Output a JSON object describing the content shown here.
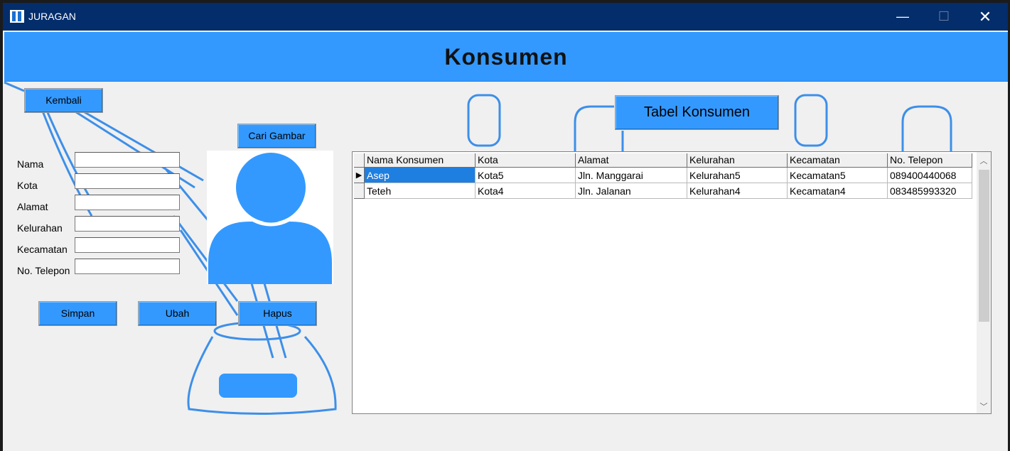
{
  "window": {
    "title": "JURAGAN",
    "minimize_glyph": "—",
    "maximize_glyph": "☐",
    "close_glyph": "✕"
  },
  "header": {
    "title": "Konsumen"
  },
  "buttons": {
    "back": "Kembali",
    "browse_image": "Cari Gambar",
    "save": "Simpan",
    "edit": "Ubah",
    "delete": "Hapus",
    "table_title": "Tabel Konsumen"
  },
  "form": {
    "fields": [
      {
        "label": "Nama",
        "value": ""
      },
      {
        "label": "Kota",
        "value": ""
      },
      {
        "label": "Alamat",
        "value": ""
      },
      {
        "label": "Kelurahan",
        "value": ""
      },
      {
        "label": "Kecamatan",
        "value": ""
      },
      {
        "label": "No. Telepon",
        "value": ""
      }
    ]
  },
  "table": {
    "columns": [
      "Nama Konsumen",
      "Kota",
      "Alamat",
      "Kelurahan",
      "Kecamatan",
      "No. Telepon"
    ],
    "rows": [
      [
        "Asep",
        "Kota5",
        "Jln. Manggarai",
        "Kelurahan5",
        "Kecamatan5",
        "089400440068"
      ],
      [
        "Teteh",
        "Kota4",
        "Jln. Jalanan",
        "Kelurahan4",
        "Kecamatan4",
        "083485993320"
      ]
    ],
    "selected_row": 0,
    "current_row_marker": "▶"
  },
  "scrollbar": {
    "up": "︿",
    "down": "﹀"
  },
  "colors": {
    "accent": "#3399ff",
    "titlebar": "#042d6b",
    "selection": "#1e7fe0"
  },
  "icons": {
    "app": "app-logo-icon",
    "avatar": "user-avatar-icon"
  }
}
